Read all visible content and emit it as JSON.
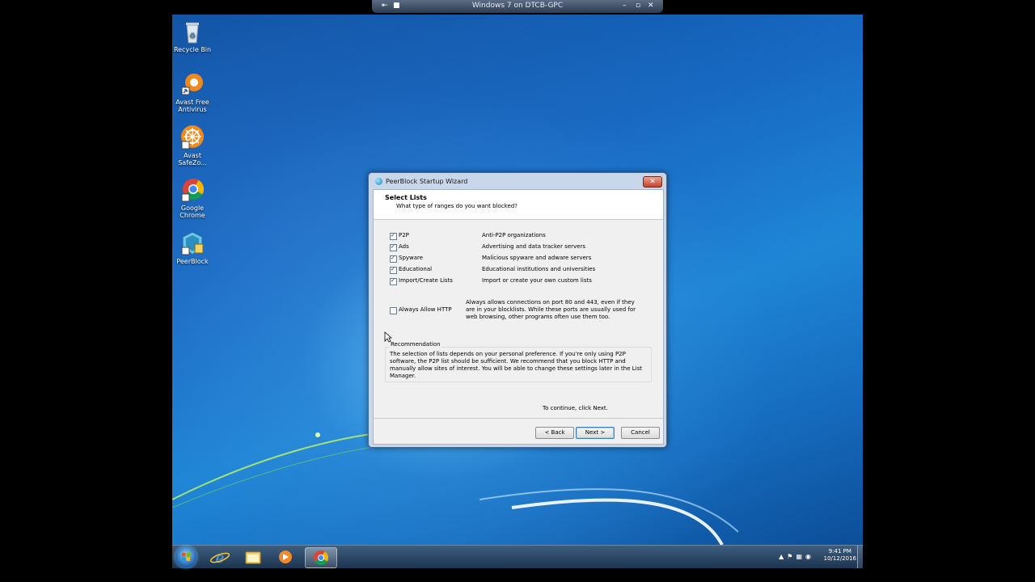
{
  "session_bar": {
    "title": "Windows 7 on DTCB-GPC"
  },
  "desktop": {
    "icons": [
      {
        "label_line1": "Recycle Bin",
        "label_line2": ""
      },
      {
        "label_line1": "Avast Free",
        "label_line2": "Antivirus"
      },
      {
        "label_line1": "Avast",
        "label_line2": "SafeZo..."
      },
      {
        "label_line1": "Google",
        "label_line2": "Chrome"
      },
      {
        "label_line1": "PeerBlock",
        "label_line2": ""
      }
    ]
  },
  "wizard": {
    "title": "PeerBlock Startup Wizard",
    "close_glyph": "✕",
    "header_title": "Select Lists",
    "header_subtitle": "What type of ranges do you want blocked?",
    "lists": [
      {
        "label": "P2P",
        "description": "Anti-P2P organizations",
        "checked": true
      },
      {
        "label": "Ads",
        "description": "Advertising and data tracker servers",
        "checked": true
      },
      {
        "label": "Spyware",
        "description": "Malicious spyware and adware servers",
        "checked": true
      },
      {
        "label": "Educational",
        "description": "Educational institutions and universities",
        "checked": true
      },
      {
        "label": "Import/Create Lists",
        "description": "Import or create your own custom lists",
        "checked": true
      }
    ],
    "http": {
      "label": "Always Allow HTTP",
      "checked": false,
      "description": "Always allows connections on port 80 and 443, even if they are in your blocklists.  While these ports are usually used for web browsing, other programs often use them too."
    },
    "recommendation": {
      "title": "Recommendation",
      "text": "The selection of lists depends on your personal preference.  If you're only using P2P software, the P2P list should be sufficient.  We recommend that you block HTTP and manually allow sites of interest.  You will be able to change these settings later in the List Manager."
    },
    "continue_text": "To continue, click Next.",
    "buttons": {
      "back": "< Back",
      "next": "Next >",
      "cancel": "Cancel"
    }
  },
  "taskbar": {
    "clock_time": "9:41 PM",
    "clock_date": "10/12/2016"
  }
}
